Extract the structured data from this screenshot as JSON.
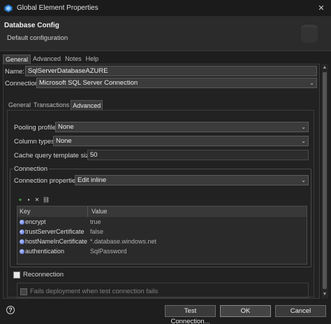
{
  "window": {
    "title": "Global Element Properties",
    "controls": {
      "close_glyph": "✕"
    }
  },
  "header": {
    "title": "Database Config",
    "subtitle": "Default configuration"
  },
  "outer_tabs": [
    "General",
    "Advanced",
    "Notes",
    "Help"
  ],
  "general": {
    "name_label": "Name:",
    "name_value": "SqlServerDatabaseAZURE",
    "connection_label": "Connection",
    "connection_value": "Microsoft SQL Server Connection"
  },
  "inner_tabs": [
    "General",
    "Transactions",
    "Advanced"
  ],
  "advanced": {
    "pooling_label": "Pooling profile",
    "pooling_value": "None",
    "column_types_label": "Column types",
    "column_types_value": "None",
    "cache_label": "Cache query template size:",
    "cache_value": "50"
  },
  "connection_group": {
    "title": "Connection",
    "properties_label": "Connection properties",
    "properties_value": "Edit inline",
    "table": {
      "headers": [
        "Key",
        "Value"
      ],
      "rows": [
        {
          "key": "encrypt",
          "value": "true"
        },
        {
          "key": "trustServerCertificate",
          "value": "false"
        },
        {
          "key": "hostNameInCertificate",
          "value": "*.database.windows.net"
        },
        {
          "key": "authentication",
          "value": "SqlPassword"
        }
      ]
    }
  },
  "reconnection_label": "Reconnection",
  "fails_deployment_label": "Fails deployment when test connection fails",
  "footer": {
    "help_glyph": "?",
    "test_connection": "Test Connection...",
    "ok": "OK",
    "cancel": "Cancel"
  },
  "colors": {
    "accent_icon": "#3d8fd6",
    "background": "#1e1e1e",
    "panel": "#222222"
  }
}
